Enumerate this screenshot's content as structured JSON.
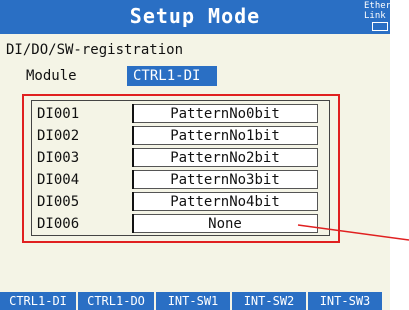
{
  "header": {
    "title": "Setup Mode",
    "badge_line1": "Ethernet",
    "badge_line2": "Link"
  },
  "section_title": "DI/DO/SW-registration",
  "module": {
    "label": "Module",
    "value": "CTRL1-DI"
  },
  "rows": [
    {
      "label": "DI001",
      "value": "PatternNo0bit"
    },
    {
      "label": "DI002",
      "value": "PatternNo1bit"
    },
    {
      "label": "DI003",
      "value": "PatternNo2bit"
    },
    {
      "label": "DI004",
      "value": "PatternNo3bit"
    },
    {
      "label": "DI005",
      "value": "PatternNo4bit"
    },
    {
      "label": "DI006",
      "value": "None"
    }
  ],
  "softkeys": [
    {
      "label": "CTRL1-DI"
    },
    {
      "label": "CTRL1-DO"
    },
    {
      "label": "INT-SW1"
    },
    {
      "label": "INT-SW2"
    },
    {
      "label": "INT-SW3"
    }
  ],
  "colors": {
    "accent": "#2a6fc4",
    "highlight": "#e02020",
    "background": "#f4f4e6"
  }
}
